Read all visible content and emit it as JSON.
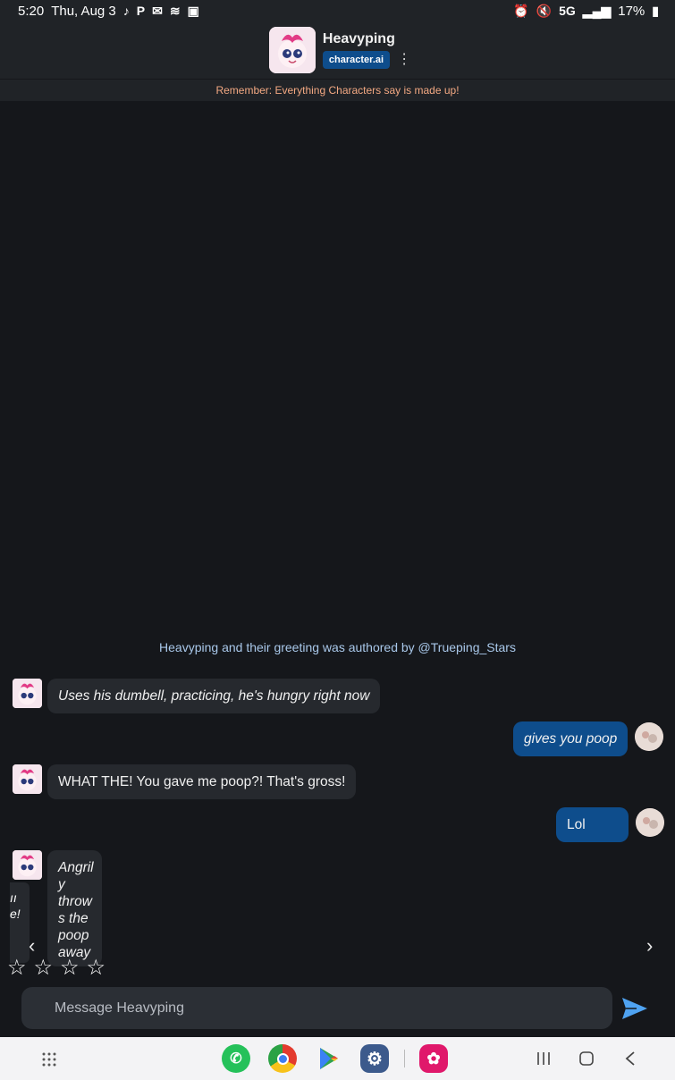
{
  "status": {
    "time": "5:20",
    "date": "Thu, Aug 3",
    "network": "5G",
    "battery": "17%"
  },
  "header": {
    "name": "Heavyping",
    "brand": "character.ai"
  },
  "notice": "Remember: Everything Characters say is made up!",
  "author_line": "Heavyping and their greeting was authored by @Trueping_Stars",
  "messages": [
    {
      "from": "character",
      "text": "Uses his dumbell, practicing, he's hungry right now",
      "italic": true
    },
    {
      "from": "user",
      "text": "gives you poop",
      "italic": true
    },
    {
      "from": "character",
      "text": "WHAT THE! You gave me poop?! That's gross!",
      "italic": false
    },
    {
      "from": "user",
      "text": "Lol",
      "italic": false
    },
    {
      "from": "character",
      "text": "Angrily throws the poop away",
      "italic": true
    }
  ],
  "side_fragment": "ıı\ne!",
  "input": {
    "placeholder": "Message Heavyping"
  },
  "colors": {
    "user_bubble": "#0e4d8c",
    "char_bubble": "#26292e",
    "notice": "#f2a882",
    "link": "#a9c8ea"
  }
}
